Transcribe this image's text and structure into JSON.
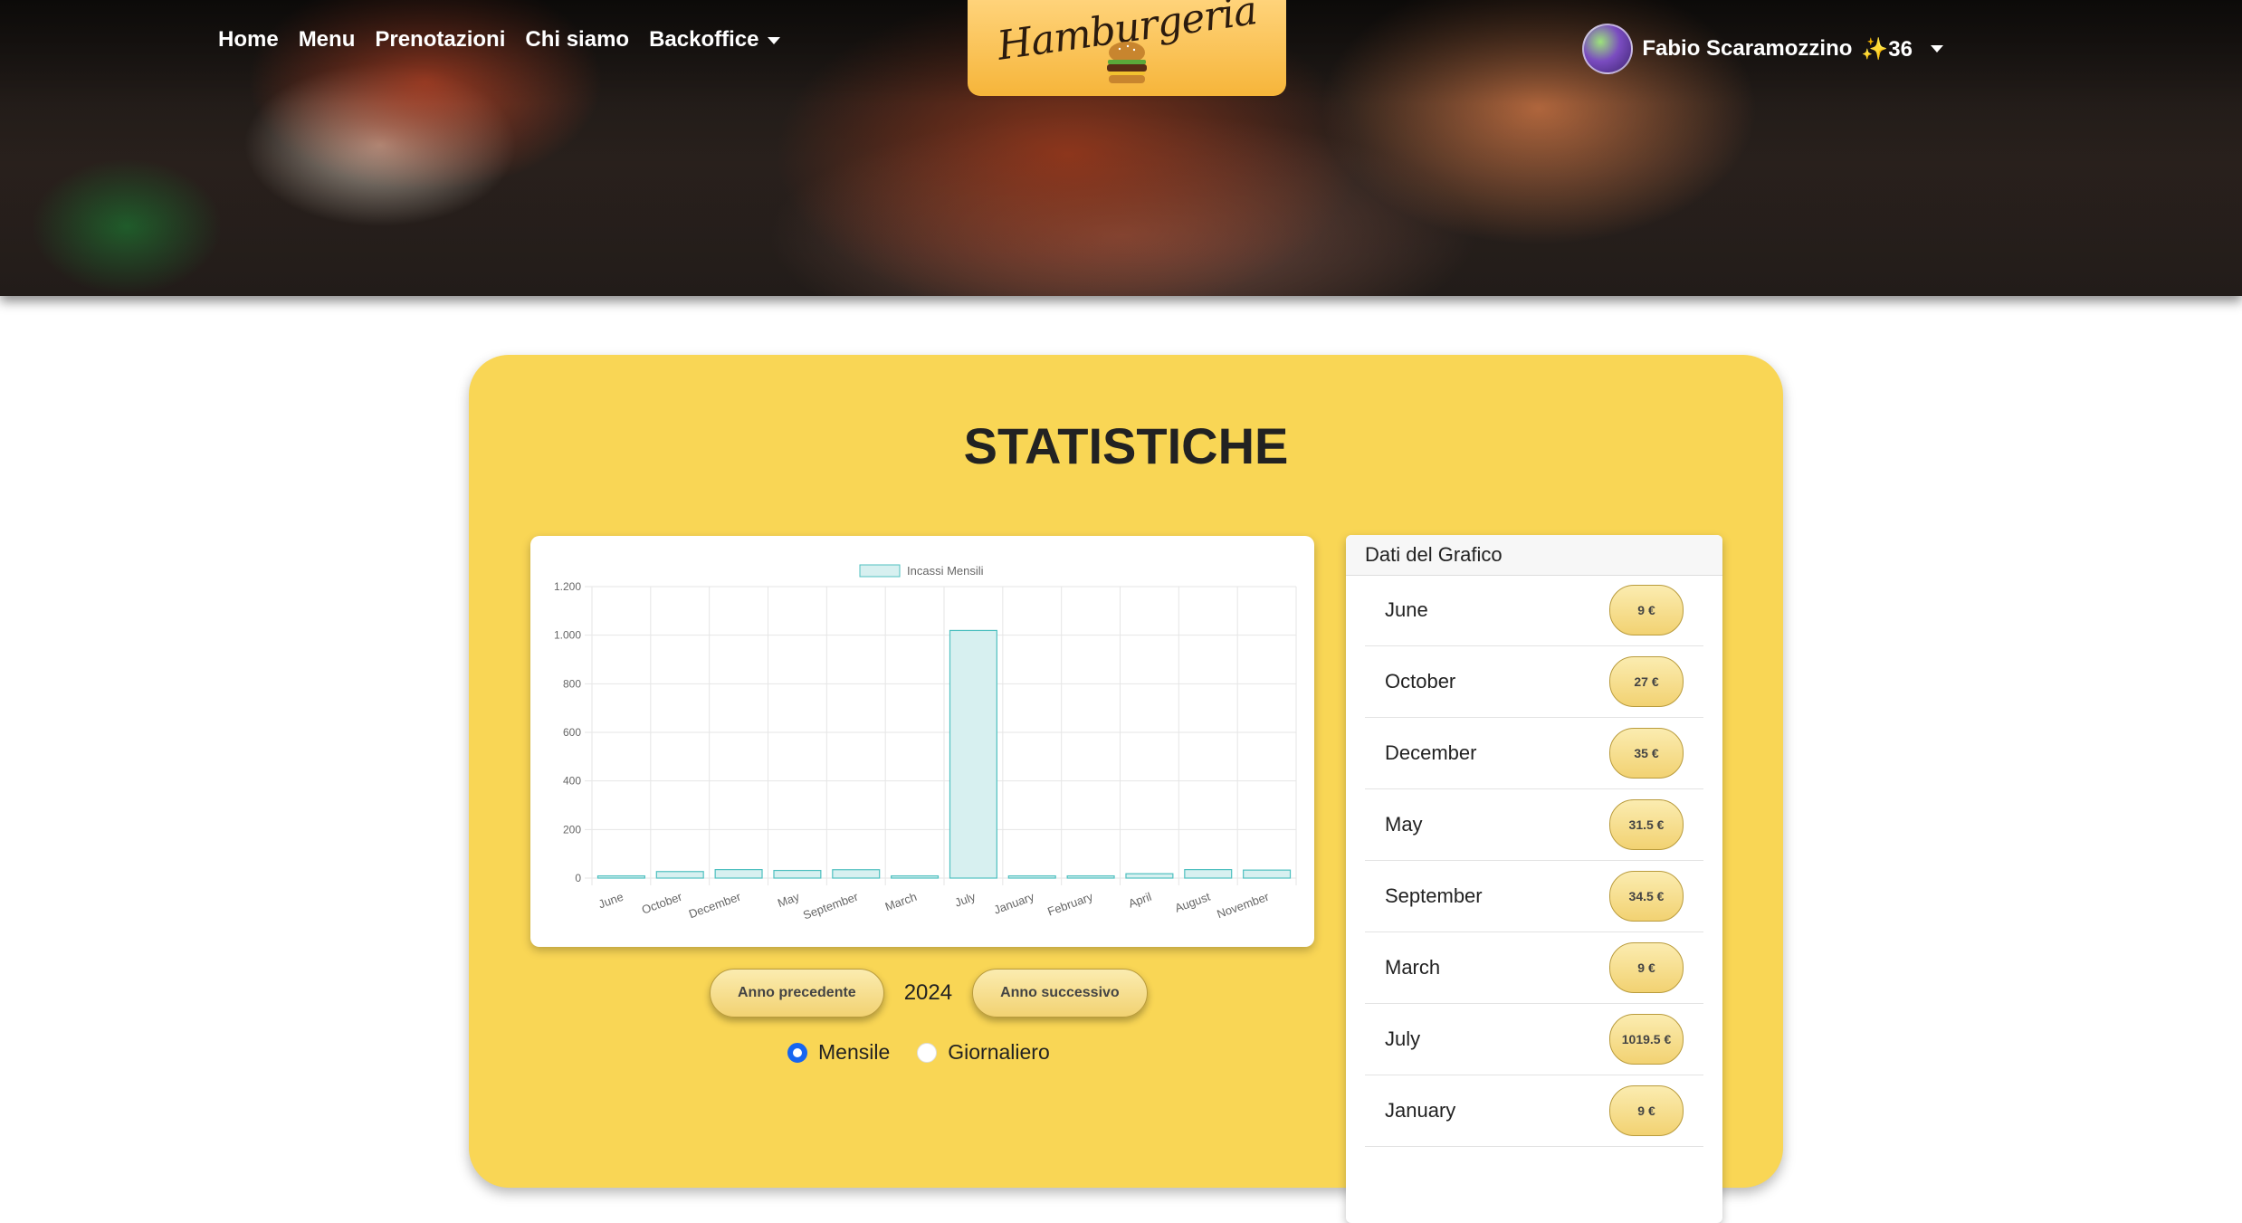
{
  "nav": {
    "items": [
      {
        "label": "Home"
      },
      {
        "label": "Menu"
      },
      {
        "label": "Prenotazioni"
      },
      {
        "label": "Chi siamo"
      },
      {
        "label": "Backoffice"
      }
    ]
  },
  "logo": {
    "text": "Hamburgeria"
  },
  "user": {
    "name": "Fabio Scaramozzino",
    "points_icon": "✨",
    "points": "36"
  },
  "page": {
    "title": "STATISTICHE"
  },
  "controls": {
    "prev_year": "Anno precedente",
    "year": "2024",
    "next_year": "Anno successivo",
    "mode_options": [
      "Mensile",
      "Giornaliero"
    ],
    "mode_selected": "Mensile"
  },
  "table": {
    "header": "Dati del Grafico",
    "rows": [
      {
        "month": "June",
        "value": "9 €"
      },
      {
        "month": "October",
        "value": "27 €"
      },
      {
        "month": "December",
        "value": "35 €"
      },
      {
        "month": "May",
        "value": "31.5 €"
      },
      {
        "month": "September",
        "value": "34.5 €"
      },
      {
        "month": "March",
        "value": "9 €"
      },
      {
        "month": "July",
        "value": "1019.5 €"
      },
      {
        "month": "January",
        "value": "9 €"
      }
    ]
  },
  "colors": {
    "accent": "#f9d655",
    "bar_fill": "#d7f0f0",
    "bar_stroke": "#4fc0c0",
    "radio": "#1665f0"
  },
  "chart_data": {
    "type": "bar",
    "categories": [
      "June",
      "October",
      "December",
      "May",
      "September",
      "March",
      "July",
      "January",
      "February",
      "April",
      "August",
      "November"
    ],
    "series": [
      {
        "name": "Incassi Mensili",
        "values": [
          9,
          27,
          35,
          31.5,
          34.5,
          9,
          1019.5,
          9,
          9,
          18,
          35,
          33
        ]
      }
    ],
    "ylim": [
      0,
      1200
    ],
    "yticks": [
      "0",
      "200",
      "400",
      "600",
      "800",
      "1.000",
      "1.200"
    ],
    "grid": true,
    "legend": "top-center"
  }
}
